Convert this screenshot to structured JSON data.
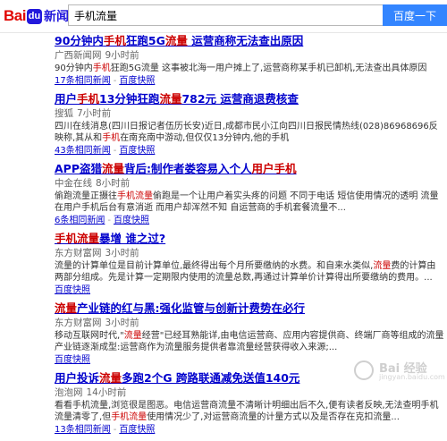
{
  "header": {
    "logo_bai": "Bai",
    "logo_du": "du",
    "logo_news": "新闻",
    "search_value": "手机流量",
    "search_button": "百度一下"
  },
  "results": [
    {
      "title_pre": "90分钟内",
      "title_hl1": "手机",
      "title_mid": "狂跑5G",
      "title_hl2": "流量",
      "title_post": " 运营商称无法查出原因",
      "source": "广西新闻网",
      "time": "9小时前",
      "abs_pre": "90分钟内",
      "abs_hl": "手机",
      "abs_post": "狂跑5G流量 这事被北海一用户摊上了,运营商称某手机已卸机,无法查出具体原因",
      "related": "17条相同新闻",
      "snapshot": "百度快照"
    },
    {
      "title_pre": "用户",
      "title_hl1": "手机",
      "title_mid": "13分钟狂跑",
      "title_hl2": "流量",
      "title_post": "782元 运营商退费核查",
      "source": "搜狐",
      "time": "7小时前",
      "abs_pre": "四川在线消息(四川日报记者伍历长安)近日,成都市民小江向四川日报民情热线(028)86968696反映称,其从和",
      "abs_hl": "手机",
      "abs_post": "在南充南中游动,但仅仅13分钟内,他的手机",
      "related": "43条相同新闻",
      "snapshot": "百度快照"
    },
    {
      "title_pre": "APP盗猎",
      "title_hl1": "流量",
      "title_mid": "背后:制作者娄容易入个人",
      "title_hl2": "用户手机",
      "title_post": "",
      "source": "中金在线",
      "time": "8小时前",
      "abs_pre": "偷跑流量正摄往",
      "abs_hl": "手机流量",
      "abs_post": "偷跑是一个让用户着实头疼的问题 不同于电话 短信使用情况的透明 流量在用户手机后台有意消逝 而用户却浑然不知 自运营商的手机套餐流量不...",
      "related": "6条相同新闻",
      "snapshot": "百度快照"
    },
    {
      "title_pre": "",
      "title_hl1": "手机流量",
      "title_mid": "暴增 谁之过?",
      "title_hl2": "",
      "title_post": "",
      "source": "东方财富网",
      "time": "3小时前",
      "abs_pre": "流量的计算单位是目前计算单位,最终得出每个月所要缴纳的水费。和自来水类似,",
      "abs_hl": "流量",
      "abs_post": "费的计算由两部分组成。先是计算一定期限内使用的流量总数,再通过计算单价计算得出所要缴纳的费用。...",
      "related": "",
      "snapshot": "百度快照"
    },
    {
      "title_pre": "",
      "title_hl1": "流量",
      "title_mid": "产业链的红与黑:强化监管与创新计费势在必行",
      "title_hl2": "",
      "title_post": "",
      "source": "东方财富网",
      "time": "3小时前",
      "abs_pre": "移动互联网时代,\"",
      "abs_hl": "流量",
      "abs_post": "经营\"已经耳熟能详,由电信运营商、应用内容提供商、终端厂商等组成的流量产业链逐渐成型:运营商作为流量服务提供者靠流量经营获得收入来源;...",
      "related": "",
      "snapshot": "百度快照"
    },
    {
      "title_pre": "用户投诉",
      "title_hl1": "流量",
      "title_mid": "多跑2个G 跨路联通减免送值140元",
      "title_hl2": "",
      "title_post": "",
      "source": "泡泡网",
      "time": "14小时前",
      "abs_pre": "看看手机流量,浏览很是图恶。电信运营商流量不清晰计明细出后不久,便有读者反映,无法查明手机流量清零了,但",
      "abs_hl": "手机流量",
      "abs_post": "使用情况少了,对运营商流量的计量方式以及是否存在克扣流量...",
      "related": "13条相同新闻",
      "snapshot": "百度快照"
    }
  ],
  "watermark": {
    "main": "Bai 经验",
    "sub": "jingyan.baidu.com"
  }
}
